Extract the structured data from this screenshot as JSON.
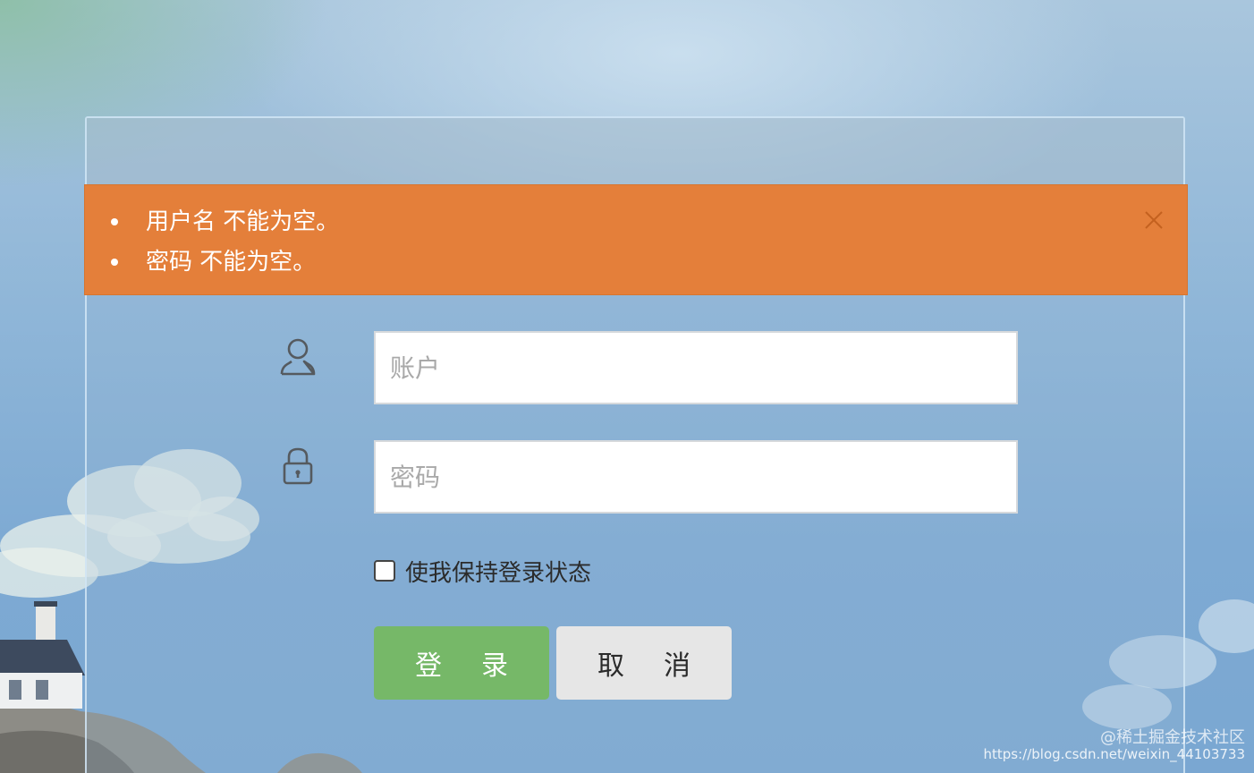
{
  "alert": {
    "messages": [
      "用户名 不能为空。",
      "密码 不能为空。"
    ],
    "close_icon": "close-icon",
    "color": "#e47f3a"
  },
  "form": {
    "username": {
      "icon": "user-icon",
      "placeholder": "账户",
      "value": ""
    },
    "password": {
      "icon": "lock-icon",
      "placeholder": "密码",
      "value": ""
    },
    "remember_label": "使我保持登录状态",
    "login_button": {
      "chars": [
        "登",
        "录"
      ],
      "color": "#76b868"
    },
    "cancel_button": {
      "chars": [
        "取",
        "消"
      ],
      "color": "#e6e6e6"
    }
  },
  "watermark": {
    "line1": "@稀土掘金技术社区",
    "line2": "https://blog.csdn.net/weixin_44103733"
  }
}
